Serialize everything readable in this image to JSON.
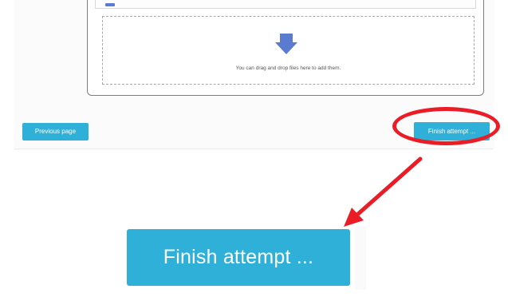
{
  "filepicker": {
    "dropzone_text": "You can drag and drop files here to add them.",
    "upload_icon": "arrow-down-icon"
  },
  "navigation": {
    "previous_label": "Previous page",
    "finish_label": "Finish attempt ..."
  },
  "zoom_callout": {
    "finish_label": "Finish attempt ..."
  },
  "colors": {
    "button": "#2fb0d8",
    "button_text": "#ffffff",
    "highlight": "#ea1d27",
    "arrow_icon": "#5b7bd1"
  }
}
